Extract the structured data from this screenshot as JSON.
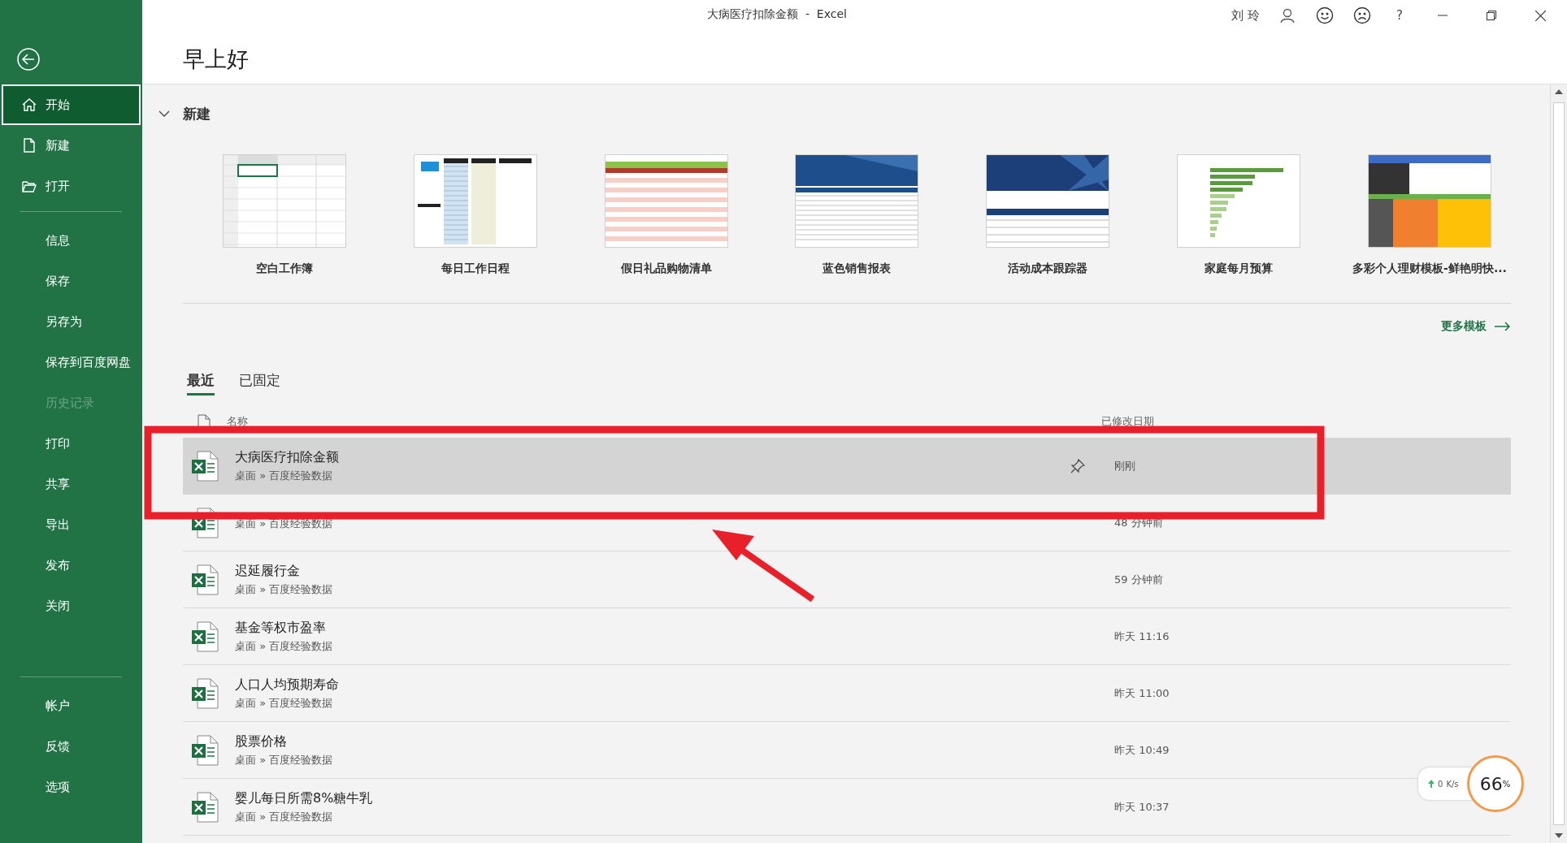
{
  "window": {
    "title": "大病医疗扣除金额  -  Excel"
  },
  "account": {
    "name": "刘 玲",
    "help": "?"
  },
  "sidebar": {
    "groups": [
      [
        {
          "label": "开始",
          "selected": true,
          "disabled": false
        },
        {
          "label": "新建",
          "selected": false,
          "disabled": false
        },
        {
          "label": "打开",
          "selected": false,
          "disabled": false
        }
      ],
      [
        {
          "label": "信息",
          "selected": false,
          "disabled": false
        },
        {
          "label": "保存",
          "selected": false,
          "disabled": false
        },
        {
          "label": "另存为",
          "selected": false,
          "disabled": false
        },
        {
          "label": "保存到百度网盘",
          "selected": false,
          "disabled": false
        },
        {
          "label": "历史记录",
          "selected": false,
          "disabled": true
        },
        {
          "label": "打印",
          "selected": false,
          "disabled": false
        },
        {
          "label": "共享",
          "selected": false,
          "disabled": false
        },
        {
          "label": "导出",
          "selected": false,
          "disabled": false
        },
        {
          "label": "发布",
          "selected": false,
          "disabled": false
        },
        {
          "label": "关闭",
          "selected": false,
          "disabled": false
        }
      ],
      [
        {
          "label": "帐户",
          "selected": false,
          "disabled": false
        },
        {
          "label": "反馈",
          "selected": false,
          "disabled": false
        },
        {
          "label": "选项",
          "selected": false,
          "disabled": false
        }
      ]
    ]
  },
  "greeting": "早上好",
  "new_section": {
    "title": "新建",
    "expanded": true,
    "more_link": "更多模板",
    "templates": [
      {
        "label": "空白工作簿"
      },
      {
        "label": "每日工作日程"
      },
      {
        "label": "假日礼品购物清单"
      },
      {
        "label": "蓝色销售报表"
      },
      {
        "label": "活动成本跟踪器"
      },
      {
        "label": "家庭每月预算"
      },
      {
        "label": "多彩个人理财模板-鲜艳明快..."
      }
    ]
  },
  "recent": {
    "tabs": [
      {
        "label": "最近",
        "selected": true
      },
      {
        "label": "已固定",
        "selected": false
      }
    ],
    "columns": [
      "名称",
      "已修改日期"
    ],
    "files": [
      {
        "name": "大病医疗扣除金额",
        "path": "桌面 » 百度经验数据",
        "modified": "刚刚",
        "selected": true
      },
      {
        "path": "桌面 » 百度经验数据",
        "modified": "48 分钟前",
        "selected": false
      },
      {
        "name": "迟延履行金",
        "path": "桌面 » 百度经验数据",
        "modified": "59 分钟前",
        "selected": false
      },
      {
        "name": "基金等权市盈率",
        "path": "桌面 » 百度经验数据",
        "modified": "昨天 11:16",
        "selected": false
      },
      {
        "name": "人口人均预期寿命",
        "path": "桌面 » 百度经验数据",
        "modified": "昨天 11:00",
        "selected": false
      },
      {
        "name": "股票价格",
        "path": "桌面 » 百度经验数据",
        "modified": "昨天 10:49",
        "selected": false
      },
      {
        "name": "婴儿每日所需8%糖牛乳",
        "path": "桌面 » 百度经验数据",
        "modified": "昨天 10:37",
        "selected": false
      }
    ]
  },
  "speed_widget": {
    "speed": "0",
    "speed_unit": "K/s",
    "percent": "66",
    "percent_sign": "%"
  }
}
